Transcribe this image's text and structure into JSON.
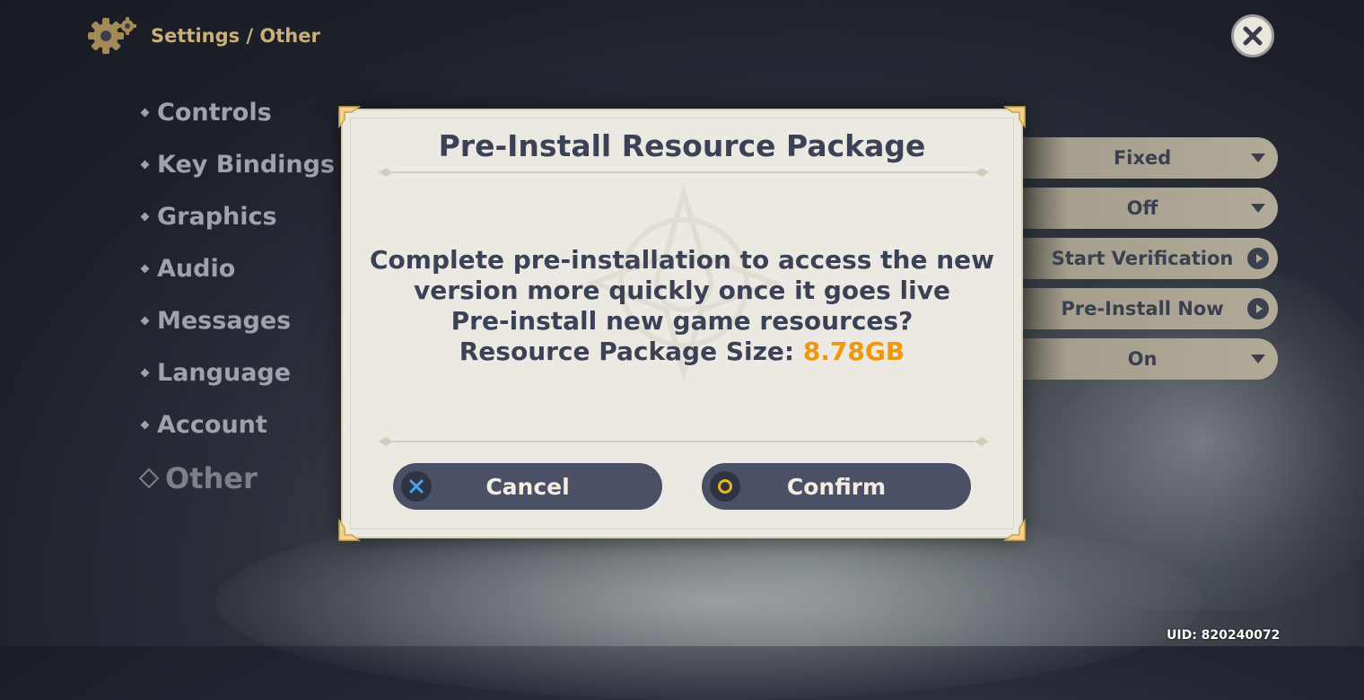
{
  "header": {
    "breadcrumb": "Settings / Other",
    "settings_icon": "gear-icon",
    "close_icon": "close-icon"
  },
  "menu": {
    "items": [
      {
        "label": "Controls"
      },
      {
        "label": "Key Bindings"
      },
      {
        "label": "Graphics"
      },
      {
        "label": "Audio"
      },
      {
        "label": "Messages"
      },
      {
        "label": "Language"
      },
      {
        "label": "Account"
      },
      {
        "label": "Other",
        "active": true
      }
    ]
  },
  "settings_controls": [
    {
      "value": "Fixed",
      "kind": "dropdown"
    },
    {
      "value": "Off",
      "kind": "dropdown"
    },
    {
      "value": "Start Verification",
      "kind": "action"
    },
    {
      "value": "Pre-Install Now",
      "kind": "action"
    },
    {
      "value": "On",
      "kind": "dropdown"
    }
  ],
  "dialog": {
    "title": "Pre-Install Resource Package",
    "line1": "Complete pre-installation to access the new",
    "line2": "version more quickly once it goes live",
    "line3": "Pre-install new game resources?",
    "size_label": "Resource Package Size: ",
    "size_value": "8.78GB",
    "cancel_label": "Cancel",
    "confirm_label": "Confirm"
  },
  "footer": {
    "uid": "UID: 820240072"
  },
  "colors": {
    "accent": "#f0970a",
    "button_bg": "#4a5166",
    "dialog_bg": "#ece9e3",
    "text_dark": "#3b4255",
    "cancel_icon": "#4aa3e8",
    "confirm_icon": "#e5b820"
  }
}
